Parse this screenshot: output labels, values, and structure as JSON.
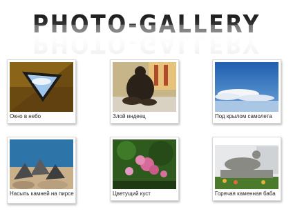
{
  "header": {
    "logo_text": "PHOTO-GALLERY"
  },
  "gallery": {
    "items": [
      {
        "caption": "Окно в небо",
        "image": "triangle-window-sky"
      },
      {
        "caption": "Злой индеец",
        "image": "statue-indian"
      },
      {
        "caption": "Под крылом самолета",
        "image": "clouds-from-plane"
      },
      {
        "caption": "Насыпь камней на пирсе",
        "image": "pier-stones"
      },
      {
        "caption": "Цветущий куст",
        "image": "flowering-bush"
      },
      {
        "caption": "Горячая каменная баба",
        "image": "stone-woman-statue"
      }
    ]
  }
}
